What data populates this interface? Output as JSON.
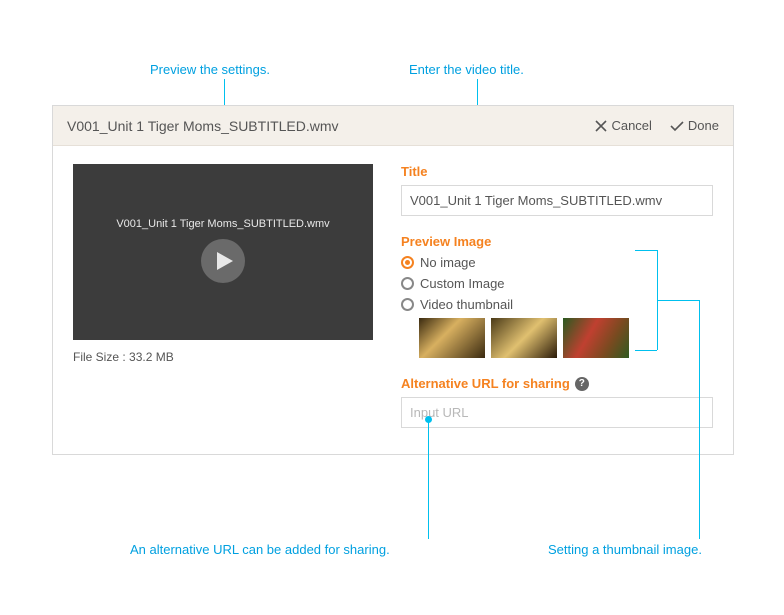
{
  "annotations": {
    "preview": "Preview the settings.",
    "title": "Enter the video title.",
    "alturl": "An alternative URL can be added for sharing.",
    "thumbnail": "Setting a thumbnail image."
  },
  "header": {
    "title": "V001_Unit 1 Tiger Moms_SUBTITLED.wmv",
    "cancel": "Cancel",
    "done": "Done"
  },
  "preview": {
    "filename": "V001_Unit 1 Tiger Moms_SUBTITLED.wmv",
    "filesize": "File Size : 33.2 MB"
  },
  "form": {
    "title_label": "Title",
    "title_value": "V001_Unit 1 Tiger Moms_SUBTITLED.wmv",
    "preview_label": "Preview Image",
    "options": {
      "noimage": "No image",
      "custom": "Custom Image",
      "videothumb": "Video thumbnail"
    },
    "alturl_label": "Alternative URL for sharing",
    "alturl_placeholder": "Input URL",
    "help_glyph": "?"
  }
}
